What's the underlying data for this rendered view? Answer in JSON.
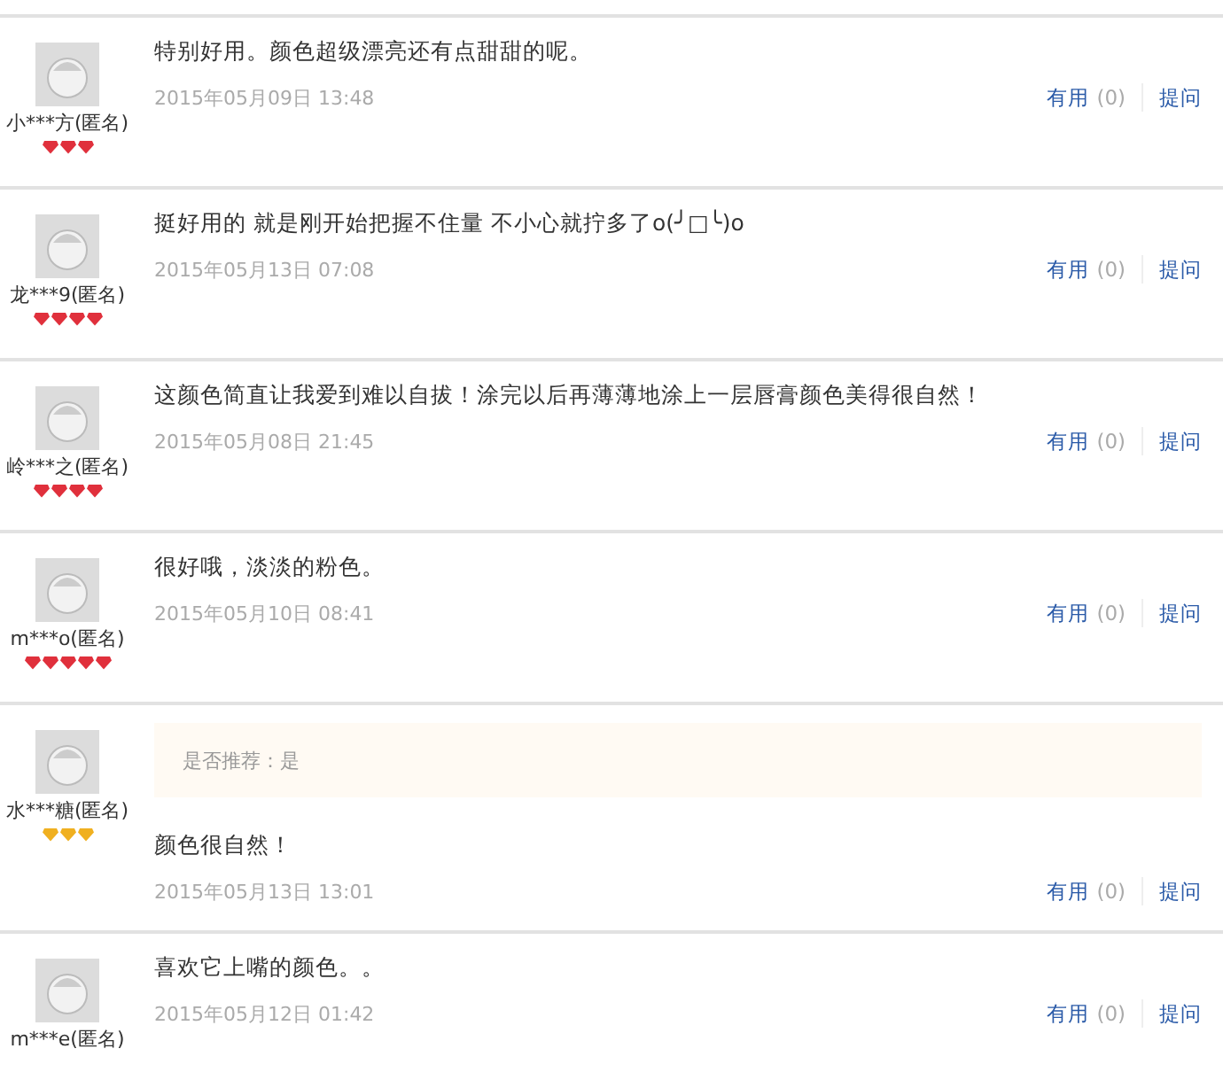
{
  "reviews": [
    {
      "user": "小***方(匿名)",
      "stars": 3,
      "color": "#e0303c",
      "text": "特别好用。颜色超级漂亮还有点甜甜的呢。",
      "date": "2015年05月09日 13:48",
      "useful": "有用",
      "count": "(0)",
      "ask": "提问"
    },
    {
      "user": "龙***9(匿名)",
      "stars": 4,
      "color": "#e0303c",
      "text": "挺好用的 就是刚开始把握不住量 不小心就拧多了o(╯□╰)o",
      "date": "2015年05月13日 07:08",
      "useful": "有用",
      "count": "(0)",
      "ask": "提问"
    },
    {
      "user": "岭***之(匿名)",
      "stars": 4,
      "color": "#e0303c",
      "text": "这颜色简直让我爱到难以自拔！涂完以后再薄薄地涂上一层唇膏颜色美得很自然！",
      "date": "2015年05月08日 21:45",
      "useful": "有用",
      "count": "(0)",
      "ask": "提问"
    },
    {
      "user": "m***o(匿名)",
      "stars": 5,
      "color": "#e0303c",
      "text": "很好哦，淡淡的粉色。",
      "date": "2015年05月10日 08:41",
      "useful": "有用",
      "count": "(0)",
      "ask": "提问"
    },
    {
      "user": "水***糖(匿名)",
      "stars": 3,
      "color": "#f0b020",
      "recommend": "是否推荐：是",
      "text": "颜色很自然！",
      "date": "2015年05月13日 13:01",
      "useful": "有用",
      "count": "(0)",
      "ask": "提问"
    },
    {
      "user": "m***e(匿名)",
      "text": "喜欢它上嘴的颜色。。",
      "date": "2015年05月12日 01:42",
      "useful": "有用",
      "count": "(0)",
      "ask": "提问"
    }
  ]
}
